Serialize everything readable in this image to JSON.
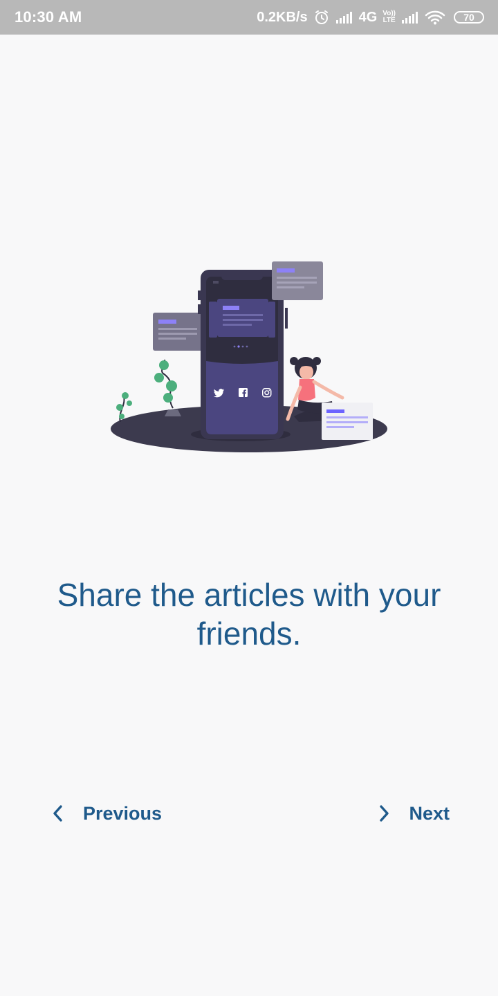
{
  "status_bar": {
    "time": "10:30 AM",
    "network_speed": "0.2KB/s",
    "network_type": "4G",
    "volte_top": "Vo))",
    "volte_bottom": "LTE",
    "battery": "70",
    "icons": [
      "alarm-icon",
      "signal-icon",
      "volte-icon",
      "signal-icon",
      "wifi-icon",
      "battery-icon"
    ]
  },
  "illustration": {
    "social_icons": [
      "twitter-icon",
      "facebook-icon",
      "instagram-icon"
    ]
  },
  "headline": "Share the articles with your friends.",
  "navigation": {
    "previous_label": "Previous",
    "previous_icon": "chevron-left-icon",
    "next_label": "Next",
    "next_icon": "chevron-right-icon"
  },
  "colors": {
    "accent": "#1f5a8b",
    "background": "#f8f8f9",
    "status_bar": "#b8b8b8"
  }
}
